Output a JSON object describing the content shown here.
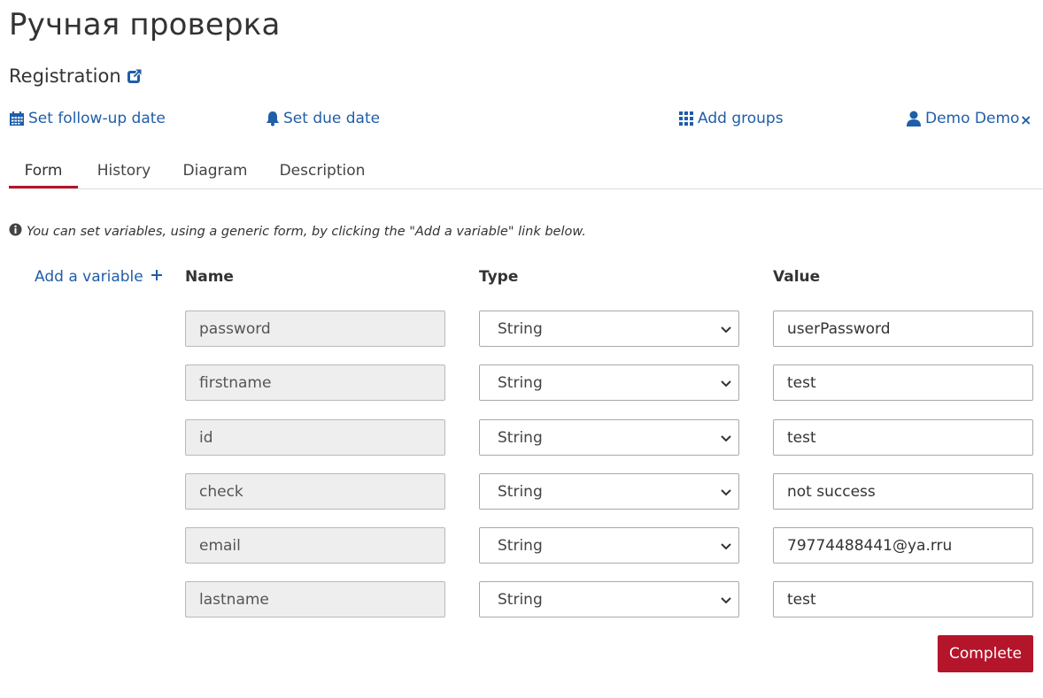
{
  "page": {
    "title": "Ручная проверка",
    "subtitle": "Registration"
  },
  "actions": {
    "follow_up": "Set follow-up date",
    "due_date": "Set due date",
    "add_groups": "Add groups",
    "assignee": "Demo Demo",
    "remove_symbol": "×"
  },
  "tabs": [
    {
      "label": "Form",
      "active": true
    },
    {
      "label": "History",
      "active": false
    },
    {
      "label": "Diagram",
      "active": false
    },
    {
      "label": "Description",
      "active": false
    }
  ],
  "form": {
    "info": "You can set variables, using a generic form, by clicking the \"Add a variable\" link below.",
    "add_variable": "Add a variable",
    "headers": {
      "name": "Name",
      "type": "Type",
      "value": "Value"
    },
    "rows": [
      {
        "name": "password",
        "type": "String",
        "value": "userPassword"
      },
      {
        "name": "firstname",
        "type": "String",
        "value": "test"
      },
      {
        "name": "id",
        "type": "String",
        "value": "test"
      },
      {
        "name": "check",
        "type": "String",
        "value": "not success"
      },
      {
        "name": "email",
        "type": "String",
        "value": "79774488441@ya.rru"
      },
      {
        "name": "lastname",
        "type": "String",
        "value": "test"
      }
    ],
    "complete": "Complete"
  },
  "colors": {
    "link": "#1f5ea8",
    "accent": "#b5152b"
  }
}
